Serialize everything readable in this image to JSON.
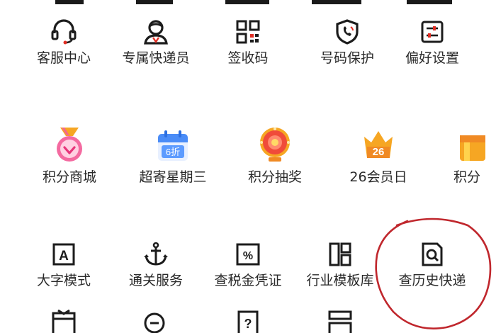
{
  "colors": {
    "annotation": "#c0272d",
    "icon_dark": "#1c1c1c",
    "text": "#2a2a2a",
    "accent_red": "#e02e24"
  },
  "row1": [
    {
      "label": "客服中心",
      "icon": "headset-icon"
    },
    {
      "label": "专属快递员",
      "icon": "courier-icon"
    },
    {
      "label": "签收码",
      "icon": "qr-code-icon"
    },
    {
      "label": "号码保护",
      "icon": "shield-phone-icon"
    },
    {
      "label": "偏好设置",
      "icon": "settings-sliders-icon"
    }
  ],
  "row2": [
    {
      "label": "积分商城",
      "icon": "medal-icon"
    },
    {
      "label": "超寄星期三",
      "icon": "calendar-discount-icon",
      "badge": "6折"
    },
    {
      "label": "积分抽奖",
      "icon": "lottery-wheel-icon"
    },
    {
      "label": "26会员日",
      "icon": "crown-icon",
      "badge": "26"
    },
    {
      "label": "积分",
      "icon": "gift-box-icon"
    }
  ],
  "row3": [
    {
      "label": "大字模式",
      "icon": "big-font-icon",
      "glyph": "A"
    },
    {
      "label": "通关服务",
      "icon": "anchor-icon"
    },
    {
      "label": "查税金凭证",
      "icon": "tax-receipt-icon",
      "glyph": "%"
    },
    {
      "label": "行业模板库",
      "icon": "template-grid-icon"
    },
    {
      "label": "查历史快递",
      "icon": "history-search-icon"
    }
  ],
  "row4": [
    {
      "icon": "gift-icon"
    },
    {
      "icon": "zoom-out-icon"
    },
    {
      "icon": "question-icon",
      "glyph": "?"
    },
    {
      "icon": "list-icon"
    }
  ]
}
